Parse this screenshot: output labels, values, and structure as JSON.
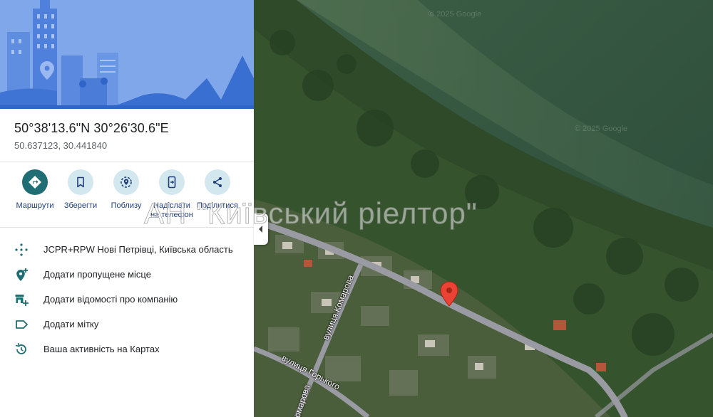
{
  "place": {
    "title": "50°38'13.6\"N 30°26'30.6\"E",
    "decimal": "50.637123, 30.441840"
  },
  "actions": [
    {
      "label": "Маршрути",
      "icon": "directions-icon"
    },
    {
      "label": "Зберегти",
      "icon": "bookmark-icon"
    },
    {
      "label": "Поблизу",
      "icon": "nearby-icon"
    },
    {
      "label": "Надіслати на телефон",
      "icon": "send-to-phone-icon"
    },
    {
      "label": "Поділитися",
      "icon": "share-icon"
    }
  ],
  "info_rows": [
    {
      "text": "JCPR+RPW Нові Петрівці, Київська область",
      "icon": "plus-code-icon"
    },
    {
      "text": "Додати пропущене місце",
      "icon": "add-place-icon"
    },
    {
      "text": "Додати відомості про компанію",
      "icon": "add-business-icon"
    },
    {
      "text": "Додати мітку",
      "icon": "label-icon"
    },
    {
      "text": "Ваша активність на Картах",
      "icon": "history-icon"
    }
  ],
  "map": {
    "watermark": "АН \"Київський ріелтор\"",
    "streets": [
      "вулиця Комарова",
      "вулиця Горького",
      "Комарова"
    ],
    "copyright": "© 2025 Google",
    "pin_color": "#ea4335"
  },
  "colors": {
    "accent": "#1f6e73",
    "link": "#1f3f7a",
    "road": "#9a9aa2"
  }
}
